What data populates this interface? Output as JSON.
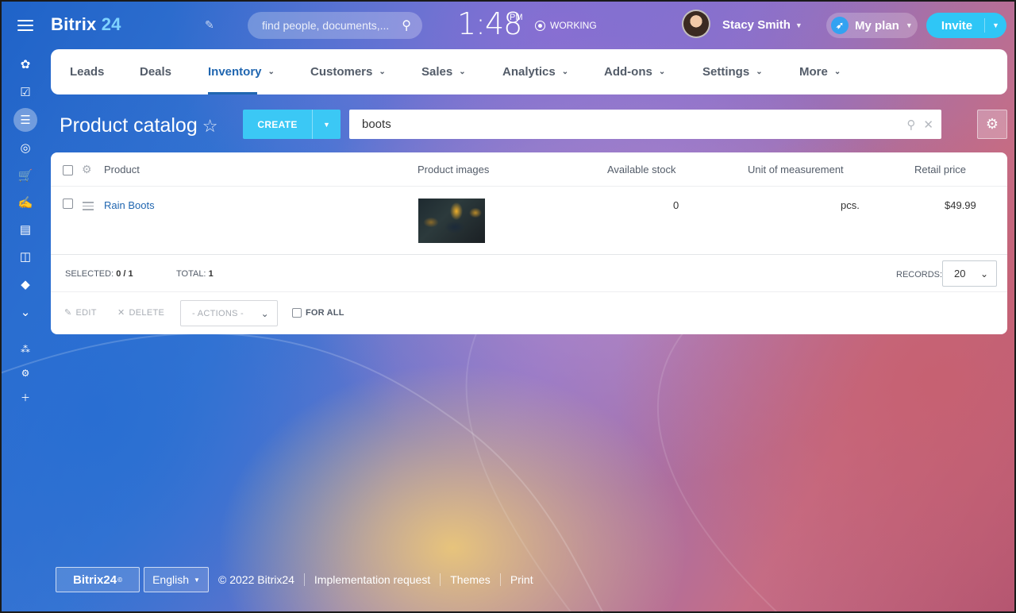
{
  "header": {
    "logo_main": "Bitrix",
    "logo_num": "24",
    "search_placeholder": "find people, documents,...",
    "clock": "1:48",
    "clock_ampm": "PM",
    "status": "WORKING",
    "user_name": "Stacy Smith",
    "plan_label": "My plan",
    "invite_label": "Invite"
  },
  "nav": {
    "items": [
      {
        "label": "Leads"
      },
      {
        "label": "Deals"
      },
      {
        "label": "Inventory"
      },
      {
        "label": "Customers"
      },
      {
        "label": "Sales"
      },
      {
        "label": "Analytics"
      },
      {
        "label": "Add-ons"
      },
      {
        "label": "Settings"
      },
      {
        "label": "More"
      }
    ],
    "active": "Inventory"
  },
  "page": {
    "title": "Product catalog",
    "create_label": "CREATE",
    "filter_value": "boots"
  },
  "grid": {
    "columns": [
      "Product",
      "Product images",
      "Available stock",
      "Unit of measurement",
      "Retail price"
    ],
    "rows": [
      {
        "product": "Rain Boots",
        "stock": "0",
        "unit": "pcs.",
        "price": "$49.99"
      }
    ],
    "selected_label": "SELECTED:",
    "selected_value": "0 / 1",
    "total_label": "TOTAL:",
    "total_value": "1",
    "records_label": "RECORDS:",
    "records_value": "20",
    "edit_label": "EDIT",
    "delete_label": "DELETE",
    "actions_label": "- ACTIONS -",
    "for_all_label": "FOR ALL"
  },
  "footer": {
    "logo_main": "Bitrix24",
    "logo_mark": "©",
    "language": "English",
    "copyright": "© 2022 Bitrix24",
    "links": [
      "Implementation request",
      "Themes",
      "Print"
    ]
  },
  "colors": {
    "accent": "#2fc6f6",
    "nav_active": "#2066b0",
    "create": "#3bc8f5"
  }
}
